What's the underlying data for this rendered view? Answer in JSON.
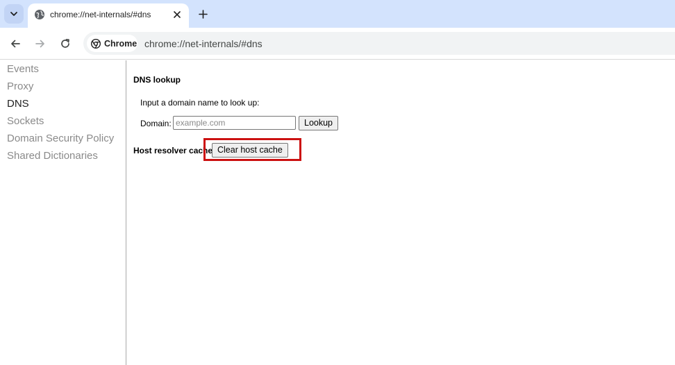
{
  "browser": {
    "tab": {
      "title": "chrome://net-internals/#dns"
    },
    "omnibox": {
      "chip_label": "Chrome",
      "url": "chrome://net-internals/#dns"
    },
    "icons": {
      "tab_search": "chevron-down-icon",
      "favicon": "globe-icon",
      "close": "close-icon",
      "new_tab": "plus-icon",
      "back": "arrow-left-icon",
      "forward": "arrow-right-icon",
      "reload": "reload-icon",
      "chrome": "chrome-logo-icon"
    },
    "colors": {
      "tabstrip": "#d3e3fd",
      "omnibox": "#f1f3f4"
    }
  },
  "sidebar": {
    "items": [
      {
        "label": "Events",
        "selected": false
      },
      {
        "label": "Proxy",
        "selected": false
      },
      {
        "label": "DNS",
        "selected": true
      },
      {
        "label": "Sockets",
        "selected": false
      },
      {
        "label": "Domain Security Policy",
        "selected": false
      },
      {
        "label": "Shared Dictionaries",
        "selected": false
      }
    ]
  },
  "main": {
    "dns_lookup": {
      "title": "DNS lookup",
      "hint": "Input a domain name to look up:",
      "domain_label": "Domain:",
      "domain_value": "",
      "domain_placeholder": "example.com",
      "lookup_button": "Lookup"
    },
    "host_resolver": {
      "title": "Host resolver cache",
      "clear_button": "Clear host cache"
    },
    "highlight_color": "#cc1111"
  }
}
